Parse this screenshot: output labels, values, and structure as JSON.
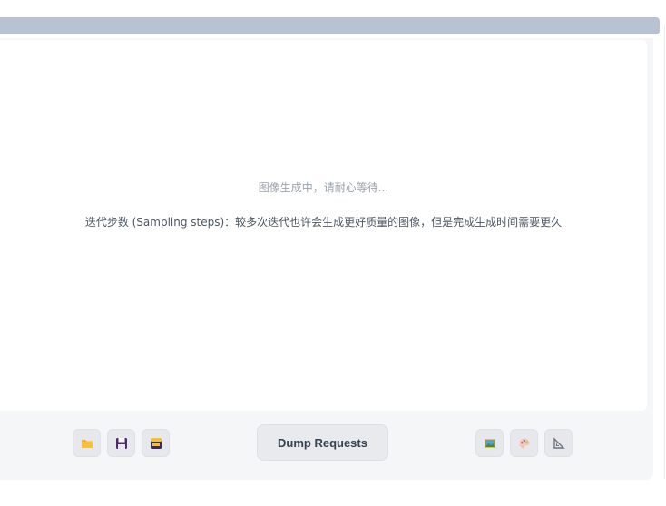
{
  "progress": {
    "fraction": 1.0,
    "color": "#b7c3d1"
  },
  "gallery": {
    "status_text": "图像生成中，请耐心等待...",
    "hint_text": "迭代步数 (Sampling steps)：较多次迭代也许会生成更好质量的图像，但是完成生成时间需要更久"
  },
  "toolbar": {
    "left_buttons": [
      {
        "icon": "open-folder-icon"
      },
      {
        "icon": "save-icon"
      },
      {
        "icon": "save-zip-icon"
      }
    ],
    "dump_label": "Dump Requests",
    "right_buttons": [
      {
        "icon": "send-to-img2img-icon"
      },
      {
        "icon": "send-to-inpaint-icon"
      },
      {
        "icon": "send-to-extras-icon"
      }
    ]
  },
  "colors": {
    "folder": "#f6b21b",
    "save": "#4c2a6e",
    "zip_top": "#f3c12a",
    "zip_body": "#3d2a5c"
  }
}
